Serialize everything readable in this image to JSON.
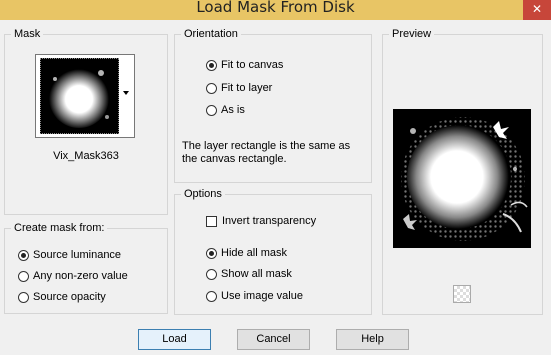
{
  "window": {
    "title": "Load Mask From Disk",
    "close_glyph": "✕"
  },
  "mask": {
    "group_label": "Mask",
    "name": "Vix_Mask363"
  },
  "create_mask_from": {
    "group_label": "Create mask from:",
    "options": [
      "Source luminance",
      "Any non-zero value",
      "Source opacity"
    ],
    "selected": "Source luminance"
  },
  "orientation": {
    "group_label": "Orientation",
    "options": [
      "Fit to canvas",
      "Fit to layer",
      "As is"
    ],
    "selected": "Fit to canvas",
    "info": "The layer rectangle is the same as the canvas rectangle."
  },
  "options": {
    "group_label": "Options",
    "invert_label": "Invert transparency",
    "invert_checked": false,
    "mask_options": [
      "Hide all mask",
      "Show all mask",
      "Use image value"
    ],
    "selected": "Hide all mask"
  },
  "preview": {
    "group_label": "Preview"
  },
  "buttons": {
    "load": "Load",
    "cancel": "Cancel",
    "help": "Help"
  },
  "colors": {
    "titlebar": "#e8c565",
    "close": "#c7463a"
  },
  "icons": [
    "close-icon",
    "dropdown-arrow-icon",
    "transparency-icon"
  ]
}
